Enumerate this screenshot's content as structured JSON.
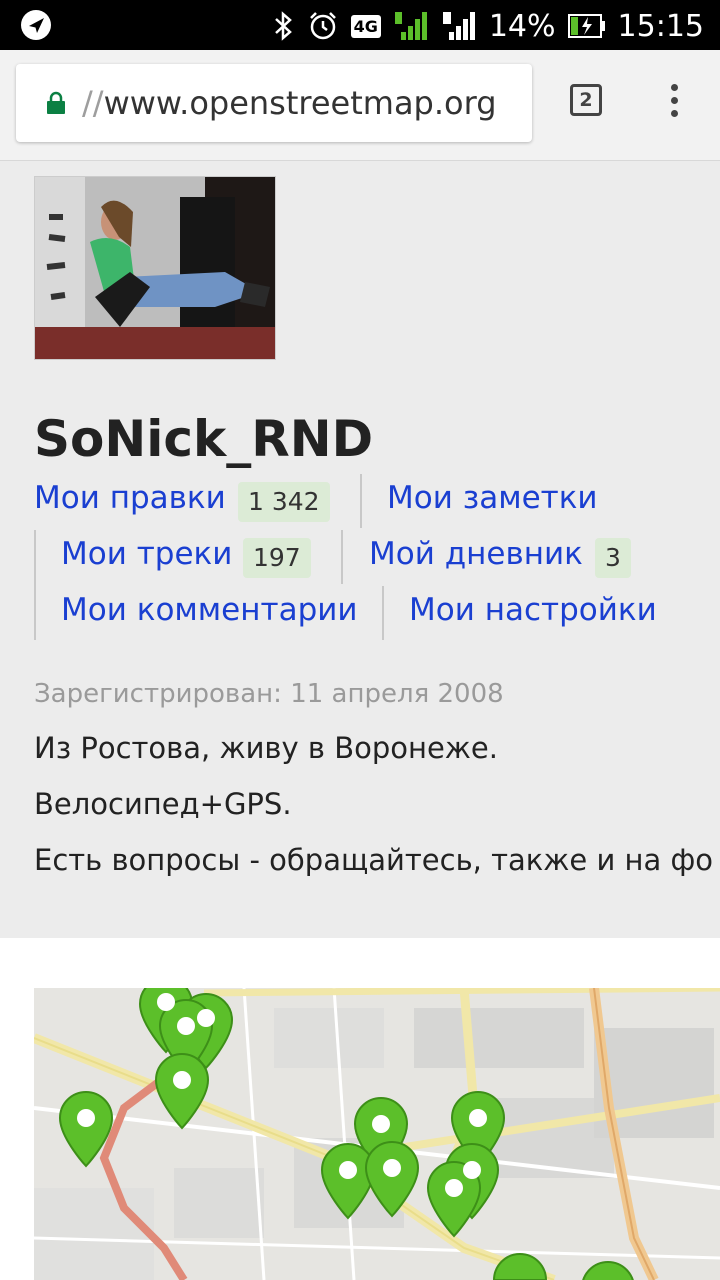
{
  "status_bar": {
    "network": "4G",
    "battery": "14%",
    "time": "15:15"
  },
  "browser": {
    "url_scheme": "//",
    "url_host": "www.openstreetmap.org",
    "tab_count": "2"
  },
  "profile": {
    "username": "SoNick_RND",
    "links": {
      "edits": "Мои правки",
      "edits_count": "1 342",
      "notes": "Мои заметки",
      "traces": "Мои треки",
      "traces_count": "197",
      "diary": "Мой дневник",
      "diary_count": "3",
      "comments": "Мои комментарии",
      "settings": "Мои настройки"
    },
    "registered": "Зарегистрирован: 11 апреля 2008",
    "bio": [
      "Из Ростова, живу в Воронеже.",
      "Велосипед+GPS.",
      "Есть вопросы - обращайтесь, также и на фо"
    ]
  },
  "colors": {
    "link": "#1a3fd1",
    "badge_bg": "#dcebd6",
    "marker": "#5cbf2a"
  }
}
